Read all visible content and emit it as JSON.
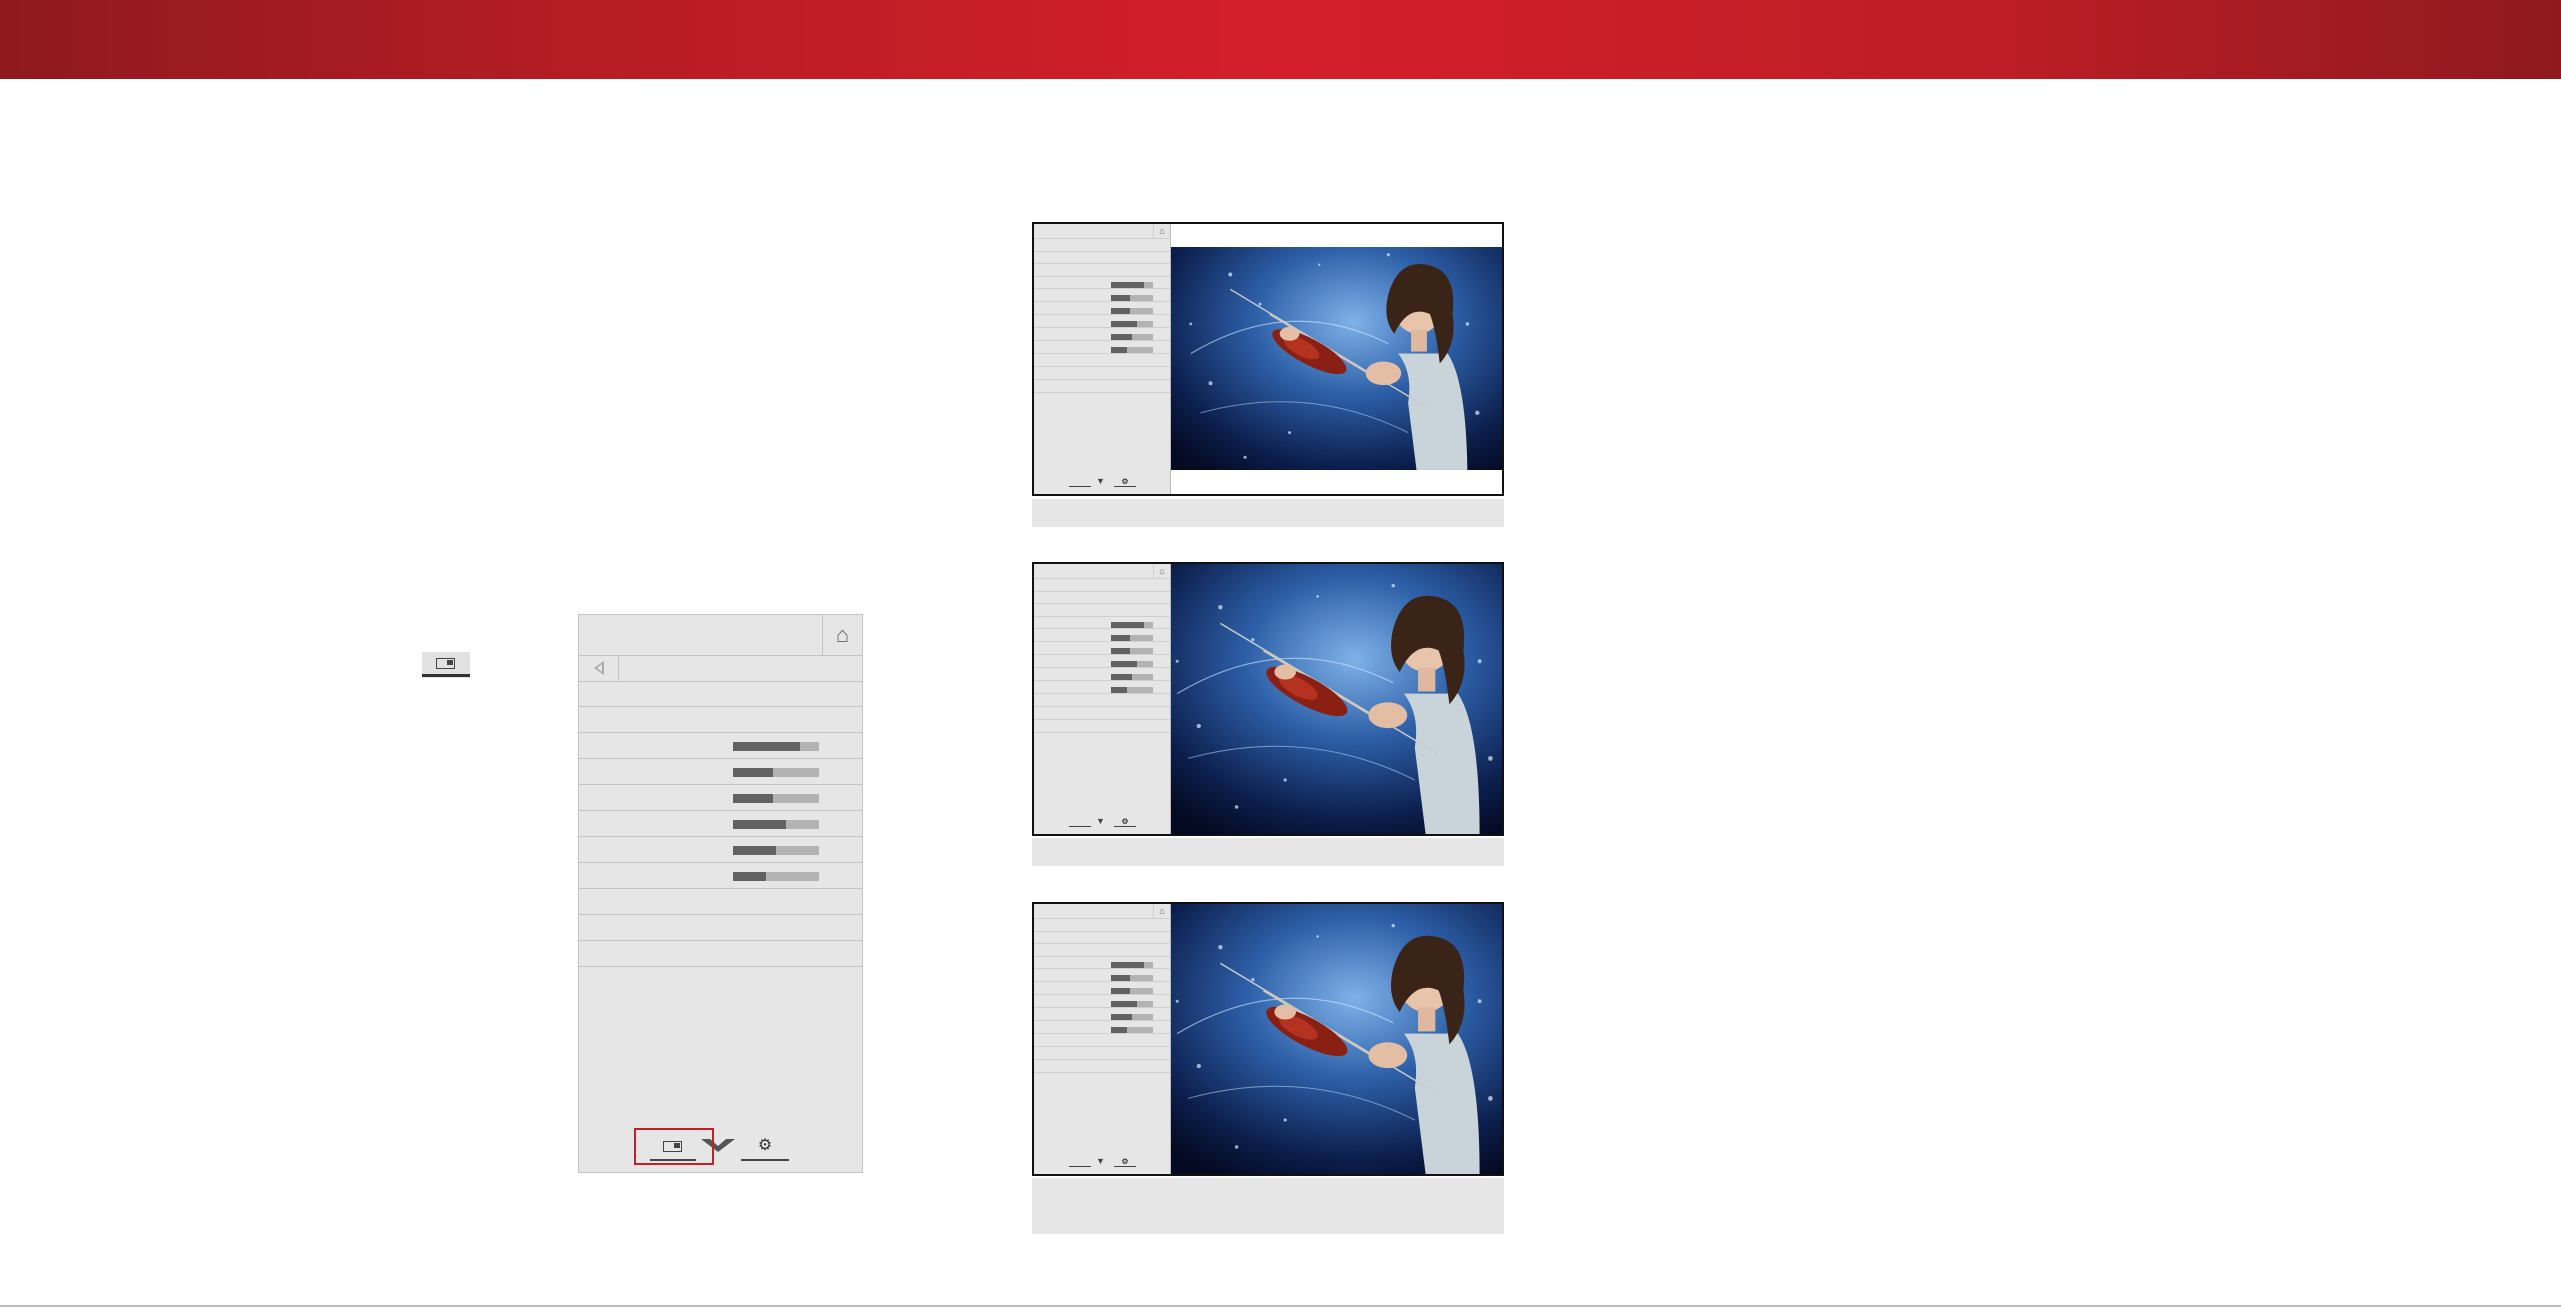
{
  "header": {
    "color_start": "#8e1a1e",
    "color_mid": "#d41f2a"
  },
  "quick_icon": {
    "icon": "picture-size-icon"
  },
  "menu": {
    "home_icon": "home-icon",
    "back_icon": "back-arrow-icon",
    "sliders": [
      {
        "level": 0.78
      },
      {
        "level": 0.46
      },
      {
        "level": 0.46
      },
      {
        "level": 0.62
      },
      {
        "level": 0.5
      },
      {
        "level": 0.38
      }
    ],
    "bottom_icons": [
      "picture-mode-icon",
      "vizio-v-icon",
      "settings-gear-icon"
    ],
    "highlight_color": "#c3202a"
  },
  "thumbnails": [
    {
      "variant": "letterbox"
    },
    {
      "variant": "full"
    },
    {
      "variant": "full"
    }
  ]
}
